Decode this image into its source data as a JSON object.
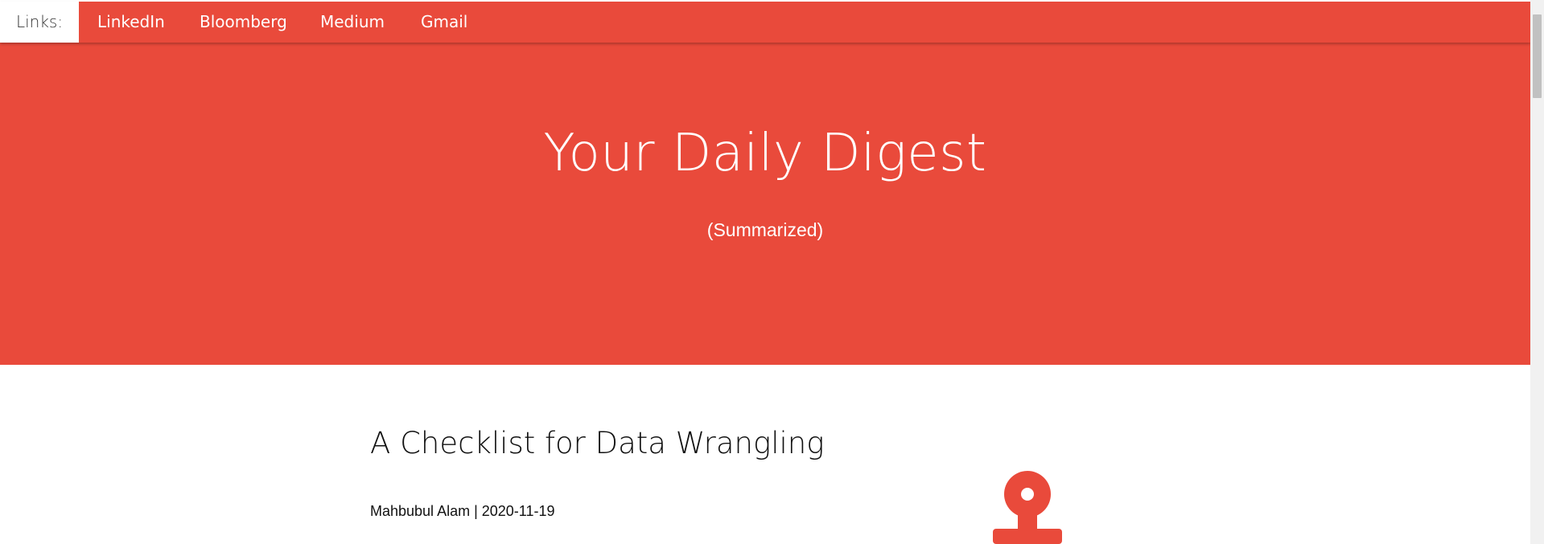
{
  "navbar": {
    "label": "Links:",
    "links": [
      {
        "label": "LinkedIn"
      },
      {
        "label": "Bloomberg"
      },
      {
        "label": "Medium"
      },
      {
        "label": "Gmail"
      }
    ]
  },
  "hero": {
    "title": "Your Daily Digest",
    "subtitle": "(Summarized)"
  },
  "article": {
    "title": "A Checklist for Data Wrangling",
    "meta": "Mahbubul Alam | 2020-11-19",
    "icon": "stamp-icon"
  },
  "colors": {
    "brand": "#e94a3b",
    "text": "#111111",
    "background": "#ffffff"
  }
}
